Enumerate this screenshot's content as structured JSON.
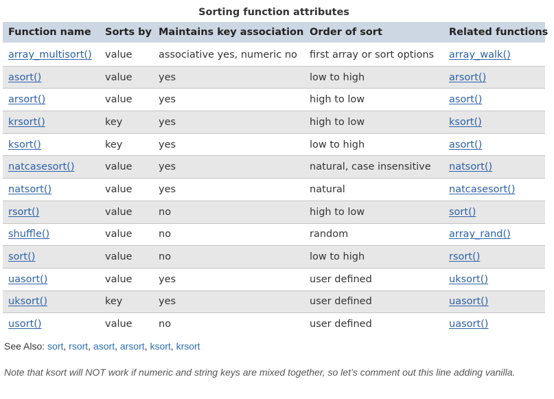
{
  "table": {
    "caption": "Sorting function attributes",
    "headers": [
      "Function name",
      "Sorts by",
      "Maintains key association",
      "Order of sort",
      "Related functions"
    ],
    "rows": [
      {
        "name": "array_multisort()",
        "sorts_by": "value",
        "key_assoc": "associative yes, numeric no",
        "order": "first array or sort options",
        "related": "array_walk()"
      },
      {
        "name": "asort()",
        "sorts_by": "value",
        "key_assoc": "yes",
        "order": "low to high",
        "related": "arsort()"
      },
      {
        "name": "arsort()",
        "sorts_by": "value",
        "key_assoc": "yes",
        "order": "high to low",
        "related": "asort()"
      },
      {
        "name": "krsort()",
        "sorts_by": "key",
        "key_assoc": "yes",
        "order": "high to low",
        "related": "ksort()"
      },
      {
        "name": "ksort()",
        "sorts_by": "key",
        "key_assoc": "yes",
        "order": "low to high",
        "related": "asort()"
      },
      {
        "name": "natcasesort()",
        "sorts_by": "value",
        "key_assoc": "yes",
        "order": "natural, case insensitive",
        "related": "natsort()"
      },
      {
        "name": "natsort()",
        "sorts_by": "value",
        "key_assoc": "yes",
        "order": "natural",
        "related": "natcasesort()"
      },
      {
        "name": "rsort()",
        "sorts_by": "value",
        "key_assoc": "no",
        "order": "high to low",
        "related": "sort()"
      },
      {
        "name": "shuffle()",
        "sorts_by": "value",
        "key_assoc": "no",
        "order": "random",
        "related": "array_rand()"
      },
      {
        "name": "sort()",
        "sorts_by": "value",
        "key_assoc": "no",
        "order": "low to high",
        "related": "rsort()"
      },
      {
        "name": "uasort()",
        "sorts_by": "value",
        "key_assoc": "yes",
        "order": "user defined",
        "related": "uksort()"
      },
      {
        "name": "uksort()",
        "sorts_by": "key",
        "key_assoc": "yes",
        "order": "user defined",
        "related": "uasort()"
      },
      {
        "name": "usort()",
        "sorts_by": "value",
        "key_assoc": "no",
        "order": "user defined",
        "related": "uasort()"
      }
    ]
  },
  "see_also": {
    "label": "See Also:",
    "links": [
      "sort",
      "rsort",
      "asort",
      "arsort",
      "ksort",
      "krsort"
    ]
  },
  "note": "Note that ksort will NOT work if numeric and string keys are mixed together, so let’s comment out this line adding vanilla.",
  "colors": {
    "header_bg": "#cdd6e3",
    "stripe_bg": "#e7e7e7",
    "link": "#2b5fa8"
  }
}
